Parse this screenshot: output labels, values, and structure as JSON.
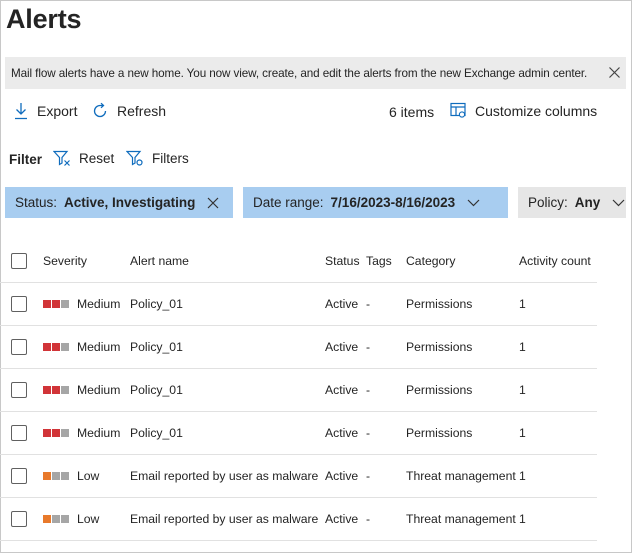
{
  "page": {
    "title": "Alerts"
  },
  "banner": {
    "text": "Mail flow alerts have a new home. You now view, create, and edit the alerts from the new Exchange admin center."
  },
  "toolbar": {
    "export_label": "Export",
    "refresh_label": "Refresh",
    "item_count": "6 items",
    "customize_label": "Customize columns"
  },
  "filter": {
    "label": "Filter",
    "reset_label": "Reset",
    "filters_label": "Filters",
    "chips": {
      "status": {
        "label": "Status:",
        "value": "Active, Investigating"
      },
      "date": {
        "label": "Date range:",
        "value": "7/16/2023-8/16/2023"
      },
      "policy": {
        "label": "Policy:",
        "value": "Any"
      }
    }
  },
  "colors": {
    "accent": "#0f6cbd",
    "chip_selected": "#a8cdf0",
    "chip_default": "#e6e6e6",
    "sev_medium": "#d13438",
    "sev_low": "#e8792b",
    "sev_inactive": "#a6a6a6"
  },
  "table": {
    "headers": {
      "severity": "Severity",
      "name": "Alert name",
      "status": "Status",
      "tags": "Tags",
      "category": "Category",
      "count": "Activity count"
    },
    "rows": [
      {
        "severity": "Medium",
        "level": 2,
        "name": "Policy_01",
        "status": "Active",
        "tags": "-",
        "category": "Permissions",
        "count": "1"
      },
      {
        "severity": "Medium",
        "level": 2,
        "name": "Policy_01",
        "status": "Active",
        "tags": "-",
        "category": "Permissions",
        "count": "1"
      },
      {
        "severity": "Medium",
        "level": 2,
        "name": "Policy_01",
        "status": "Active",
        "tags": "-",
        "category": "Permissions",
        "count": "1"
      },
      {
        "severity": "Medium",
        "level": 2,
        "name": "Policy_01",
        "status": "Active",
        "tags": "-",
        "category": "Permissions",
        "count": "1"
      },
      {
        "severity": "Low",
        "level": 1,
        "name": "Email reported by user as malware",
        "status": "Active",
        "tags": "-",
        "category": "Threat management",
        "count": "1"
      },
      {
        "severity": "Low",
        "level": 1,
        "name": "Email reported by user as malware",
        "status": "Active",
        "tags": "-",
        "category": "Threat management",
        "count": "1"
      }
    ]
  }
}
